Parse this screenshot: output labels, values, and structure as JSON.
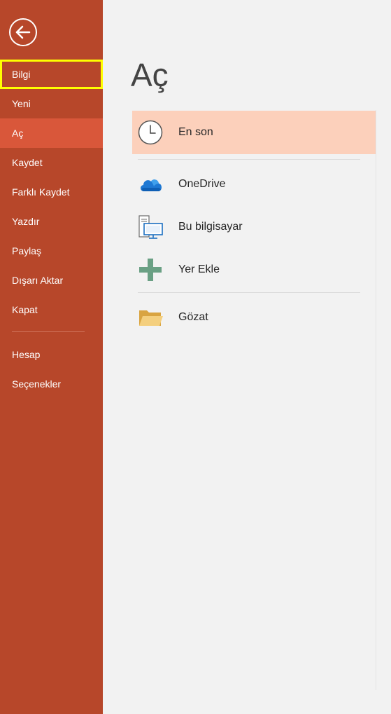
{
  "sidebar": {
    "back_icon": "back-arrow-icon",
    "items": [
      {
        "label": "Bilgi"
      },
      {
        "label": "Yeni"
      },
      {
        "label": "Aç"
      },
      {
        "label": "Kaydet"
      },
      {
        "label": "Farklı Kaydet"
      },
      {
        "label": "Yazdır"
      },
      {
        "label": "Paylaş"
      },
      {
        "label": "Dışarı Aktar"
      },
      {
        "label": "Kapat"
      },
      {
        "label": "Hesap"
      },
      {
        "label": "Seçenekler"
      }
    ],
    "active_item": "Aç",
    "highlighted_item": "Bilgi"
  },
  "main": {
    "title": "Aç",
    "options": [
      {
        "label": "En son",
        "icon": "clock-icon"
      },
      {
        "label": "OneDrive",
        "icon": "cloud-icon"
      },
      {
        "label": "Bu bilgisayar",
        "icon": "computer-icon"
      },
      {
        "label": "Yer Ekle",
        "icon": "plus-icon"
      },
      {
        "label": "Gözat",
        "icon": "folder-icon"
      }
    ]
  },
  "colors": {
    "sidebar": "#b7472a",
    "sidebar_active": "#d9573a",
    "selected_option": "#fcd0bb",
    "highlight_outline": "#ffff00",
    "background": "#f2f2f2"
  }
}
